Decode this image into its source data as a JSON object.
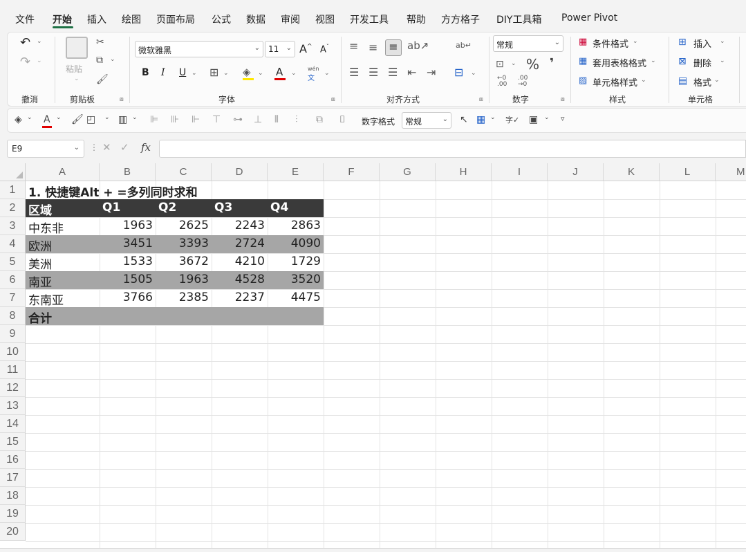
{
  "menu": {
    "tabs": [
      "文件",
      "开始",
      "插入",
      "绘图",
      "页面布局",
      "公式",
      "数据",
      "审阅",
      "视图",
      "开发工具",
      "帮助",
      "方方格子",
      "DIY工具箱",
      "Power Pivot"
    ],
    "active_tab": "开始"
  },
  "ribbon": {
    "undo_group": "撤消",
    "clipboard": {
      "paste": "粘贴",
      "label": "剪贴板"
    },
    "font": {
      "name": "微软雅黑",
      "size": "11",
      "label": "字体",
      "bold": "B",
      "italic": "I",
      "underline": "U",
      "grow": "A^",
      "shrink": "A^",
      "wen": "wén",
      "wen_char": "文"
    },
    "alignment": {
      "label": "对齐方式"
    },
    "number": {
      "format": "常规",
      "label": "数字",
      "percent": "%",
      "comma": "❜"
    },
    "styles": {
      "conditional": "条件格式",
      "table": "套用表格格式",
      "cell": "单元格样式",
      "label": "样式"
    },
    "cells": {
      "insert": "插入",
      "delete": "删除",
      "format": "格式",
      "label": "单元格"
    }
  },
  "qat": {
    "number_format_label": "数字格式",
    "number_format_value": "常规",
    "caret": "▿"
  },
  "formula_bar": {
    "name_box": "E9",
    "fx": "fx",
    "value": ""
  },
  "sheet": {
    "columns": [
      "A",
      "B",
      "C",
      "D",
      "E",
      "F",
      "G",
      "H",
      "I",
      "J",
      "K",
      "L",
      "M"
    ],
    "rows": [
      "1",
      "2",
      "3",
      "4",
      "5",
      "6",
      "7",
      "8",
      "9",
      "10",
      "11",
      "12",
      "13",
      "14",
      "15",
      "16",
      "17",
      "18",
      "19",
      "20"
    ],
    "title": "1. 快捷键Alt + =多列同时求和",
    "header": [
      "区域",
      "Q1",
      "Q2",
      "Q3",
      "Q4"
    ],
    "data": [
      {
        "region": "中东非",
        "q1": "1963",
        "q2": "2625",
        "q3": "2243",
        "q4": "2863"
      },
      {
        "region": "欧洲",
        "q1": "3451",
        "q2": "3393",
        "q3": "2724",
        "q4": "4090"
      },
      {
        "region": "美洲",
        "q1": "1533",
        "q2": "3672",
        "q3": "4210",
        "q4": "1729"
      },
      {
        "region": "南亚",
        "q1": "1505",
        "q2": "1963",
        "q3": "4528",
        "q4": "3520"
      },
      {
        "region": "东南亚",
        "q1": "3766",
        "q2": "2385",
        "q3": "2237",
        "q4": "4475"
      }
    ],
    "total_label": "合计"
  }
}
